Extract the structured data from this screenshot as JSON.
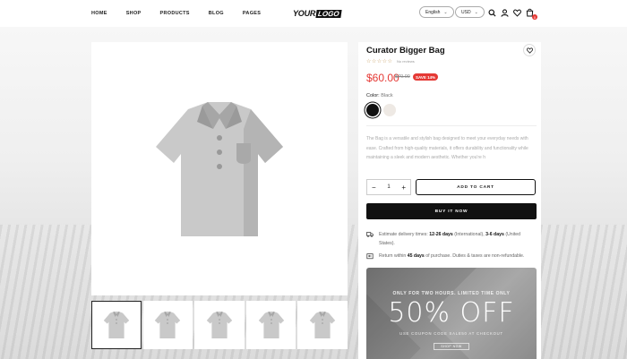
{
  "nav": {
    "items": [
      "HOME",
      "SHOP",
      "PRODUCTS",
      "BLOG",
      "PAGES"
    ]
  },
  "logo": {
    "part1": "YOUR",
    "part2": "LOGO"
  },
  "header": {
    "language": "English",
    "currency": "USD",
    "cart_count": "0"
  },
  "product": {
    "title": "Curator Bigger Bag",
    "stars": "☆☆☆☆☆",
    "reviews": "No reviews",
    "price": "$60.00",
    "old_price": "$70.00",
    "save_badge": "SAVE 14%",
    "color_label": "Color:",
    "color_value": "Black",
    "description": "The Bag is a versatile and stylish bag designed to meet your everyday needs with ease. Crafted from high-quality materials, it offers durability and functionality while maintaining a sleek and modern aesthetic. Whether you're h",
    "quantity": "1",
    "qty_minus": "−",
    "qty_plus": "+",
    "add_to_cart": "ADD TO CART",
    "buy_now": "BUY IT NOW"
  },
  "info": {
    "delivery_pre": "Estimate delivery times: ",
    "delivery_b1": "12-26 days",
    "delivery_mid": " (International), ",
    "delivery_b2": "3-6 days",
    "delivery_post": " (United States).",
    "return_pre": "Return within ",
    "return_b": "45 days",
    "return_post": " of purchase. Duties & taxes are non-refundable."
  },
  "promo": {
    "top": "ONLY FOR TWO HOURS. LIMITED TIME ONLY",
    "big": "50% OFF",
    "code": "USE COUPON CODE SALE50 AT CHECKOUT",
    "button": "SHOP NOW"
  },
  "colors": {
    "accent": "#e53935",
    "dark": "#111111",
    "star": "#c8a064"
  },
  "icons": [
    "search-icon",
    "user-icon",
    "heart-icon",
    "bag-icon",
    "truck-icon",
    "return-icon"
  ]
}
